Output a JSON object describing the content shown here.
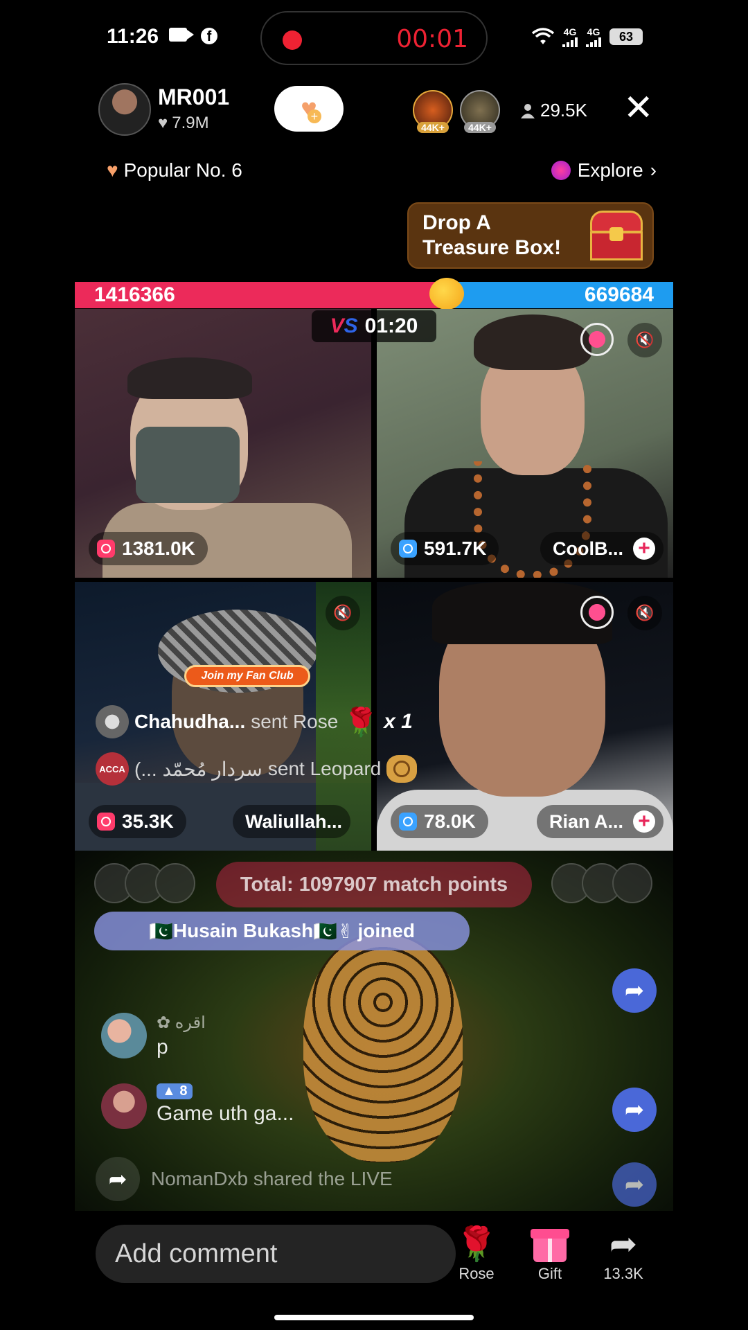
{
  "status_bar": {
    "time": "11:26",
    "record_time": "00:01",
    "network_1": "4G",
    "network_2": "4G",
    "battery": "63"
  },
  "host": {
    "name": "MR001",
    "likes": "7.9M"
  },
  "top_viewers": [
    {
      "badge": "44K+"
    },
    {
      "badge": "44K+"
    }
  ],
  "viewer_count": "29.5K",
  "popular": "Popular No. 6",
  "explore": "Explore",
  "treasure": {
    "line1": "Drop A",
    "line2": "Treasure Box!"
  },
  "battle": {
    "left_score": "1416366",
    "right_score": "669684",
    "timer": "01:20",
    "vs": "VS"
  },
  "tiles": [
    {
      "score": "1381.0K",
      "name": ""
    },
    {
      "score": "591.7K",
      "name": "CoolB..."
    },
    {
      "score": "35.3K",
      "name": "Waliullah..."
    },
    {
      "score": "78.0K",
      "name": "Rian A..."
    }
  ],
  "fan_club": "Join my Fan Club",
  "gifts": [
    {
      "user": "Chahudha...",
      "action": "sent Rose",
      "count": "x 1"
    },
    {
      "user": "(... سردار مُحمّد",
      "action": "sent Leopard",
      "avatar_text": "ACCA"
    }
  ],
  "total_points": "Total: 1097907 match points",
  "joined": {
    "flag": "🇵🇰",
    "user": "Husain Bukash",
    "emoji": "🇵🇰✌",
    "text": "joined"
  },
  "comments": [
    {
      "meta": "✿ اقره",
      "text": "p"
    },
    {
      "level": "8",
      "text": "Game uth ga..."
    }
  ],
  "share_notice": "NomanDxb shared the LIVE",
  "bottom": {
    "comment_placeholder": "Add comment",
    "rose_label": "Rose",
    "gift_label": "Gift",
    "share_count": "13.3K"
  },
  "colors": {
    "red_team": "#ec2a5a",
    "blue_team": "#1e9cf0",
    "record_red": "#ee2233"
  }
}
